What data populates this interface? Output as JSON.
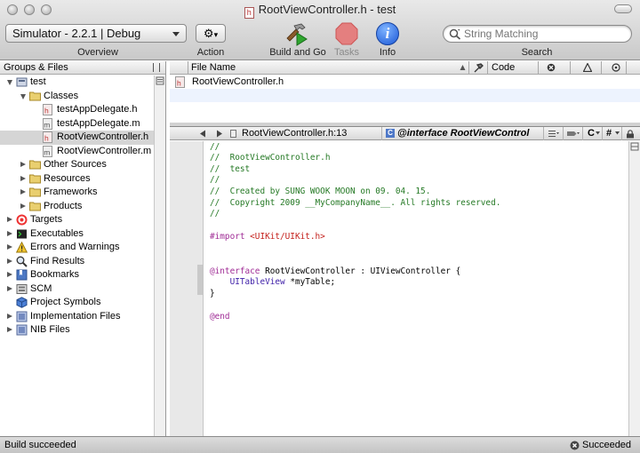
{
  "window": {
    "title": "RootViewController.h - test",
    "title_icon_glyph": "h"
  },
  "toolbar": {
    "overview_value": "Simulator - 2.2.1 | Debug",
    "overview_label": "Overview",
    "action_label": "Action",
    "build_label": "Build and Go",
    "tasks_label": "Tasks",
    "info_label": "Info",
    "info_glyph": "i",
    "search_placeholder": "String Matching",
    "search_label": "Search",
    "gear_glyph": "⚙",
    "caret_glyph": "▾"
  },
  "sidebar": {
    "header": "Groups & Files",
    "items": [
      {
        "label": "test",
        "level": 0,
        "disclosure": "open",
        "icon": "project-icon"
      },
      {
        "label": "Classes",
        "level": 1,
        "disclosure": "open",
        "icon": "folder-icon"
      },
      {
        "label": "testAppDelegate.h",
        "level": 2,
        "disclosure": "none",
        "icon": "header-file-icon"
      },
      {
        "label": "testAppDelegate.m",
        "level": 2,
        "disclosure": "none",
        "icon": "source-file-icon"
      },
      {
        "label": "RootViewController.h",
        "level": 2,
        "disclosure": "none",
        "icon": "header-file-icon",
        "selected": true
      },
      {
        "label": "RootViewController.m",
        "level": 2,
        "disclosure": "none",
        "icon": "source-file-icon"
      },
      {
        "label": "Other Sources",
        "level": 1,
        "disclosure": "closed",
        "icon": "folder-icon"
      },
      {
        "label": "Resources",
        "level": 1,
        "disclosure": "closed",
        "icon": "folder-icon"
      },
      {
        "label": "Frameworks",
        "level": 1,
        "disclosure": "closed",
        "icon": "folder-icon"
      },
      {
        "label": "Products",
        "level": 1,
        "disclosure": "closed",
        "icon": "folder-icon"
      },
      {
        "label": "Targets",
        "level": 0,
        "disclosure": "closed",
        "icon": "target-icon"
      },
      {
        "label": "Executables",
        "level": 0,
        "disclosure": "closed",
        "icon": "executable-icon"
      },
      {
        "label": "Errors and Warnings",
        "level": 0,
        "disclosure": "closed",
        "icon": "warning-icon"
      },
      {
        "label": "Find Results",
        "level": 0,
        "disclosure": "closed",
        "icon": "magnifier-icon"
      },
      {
        "label": "Bookmarks",
        "level": 0,
        "disclosure": "closed",
        "icon": "bookmarks-icon"
      },
      {
        "label": "SCM",
        "level": 0,
        "disclosure": "closed",
        "icon": "scm-icon"
      },
      {
        "label": "Project Symbols",
        "level": 0,
        "disclosure": "none",
        "icon": "symbols-cube-icon"
      },
      {
        "label": "Implementation Files",
        "level": 0,
        "disclosure": "closed",
        "icon": "smart-group-icon"
      },
      {
        "label": "NIB Files",
        "level": 0,
        "disclosure": "closed",
        "icon": "smart-group-icon"
      }
    ]
  },
  "files": {
    "columns": {
      "file_name": "File Name",
      "code": "Code"
    },
    "header_icons": [
      "build-hammer-icon",
      "errors-x-icon",
      "warnings-triangle-icon",
      "target-membership-icon"
    ],
    "rows": [
      {
        "name": "RootViewController.h",
        "icon": "header-file-icon"
      }
    ]
  },
  "editor": {
    "file_popup": "RootViewController.h:13",
    "symbol_popup": "@interface RootViewControl",
    "symbol_badge": "C",
    "nav_extra": [
      "C",
      "#"
    ],
    "code_lines": [
      [
        {
          "t": "//",
          "c": "comment"
        }
      ],
      [
        {
          "t": "//  RootViewController.h",
          "c": "comment"
        }
      ],
      [
        {
          "t": "//  test",
          "c": "comment"
        }
      ],
      [
        {
          "t": "//",
          "c": "comment"
        }
      ],
      [
        {
          "t": "//  Created by SUNG WOOK MOON on 09. 04. 15.",
          "c": "comment"
        }
      ],
      [
        {
          "t": "//  Copyright 2009 __MyCompanyName__. All rights reserved.",
          "c": "comment"
        }
      ],
      [
        {
          "t": "//",
          "c": "comment"
        }
      ],
      [],
      [
        {
          "t": "#import ",
          "c": "keyword"
        },
        {
          "t": "<UIKit/UIKit.h>",
          "c": "string"
        }
      ],
      [],
      [],
      [
        {
          "t": "@interface",
          "c": "keyword"
        },
        {
          "t": " RootViewController : UIViewController {",
          "c": "plain"
        }
      ],
      [
        {
          "t": "    ",
          "c": "plain"
        },
        {
          "t": "UITableView",
          "c": "type"
        },
        {
          "t": " *myTable;",
          "c": "plain"
        }
      ],
      [
        {
          "t": "}",
          "c": "plain"
        }
      ],
      [],
      [
        {
          "t": "@end",
          "c": "keyword"
        }
      ]
    ]
  },
  "status": {
    "left": "Build succeeded",
    "right": "Succeeded"
  }
}
